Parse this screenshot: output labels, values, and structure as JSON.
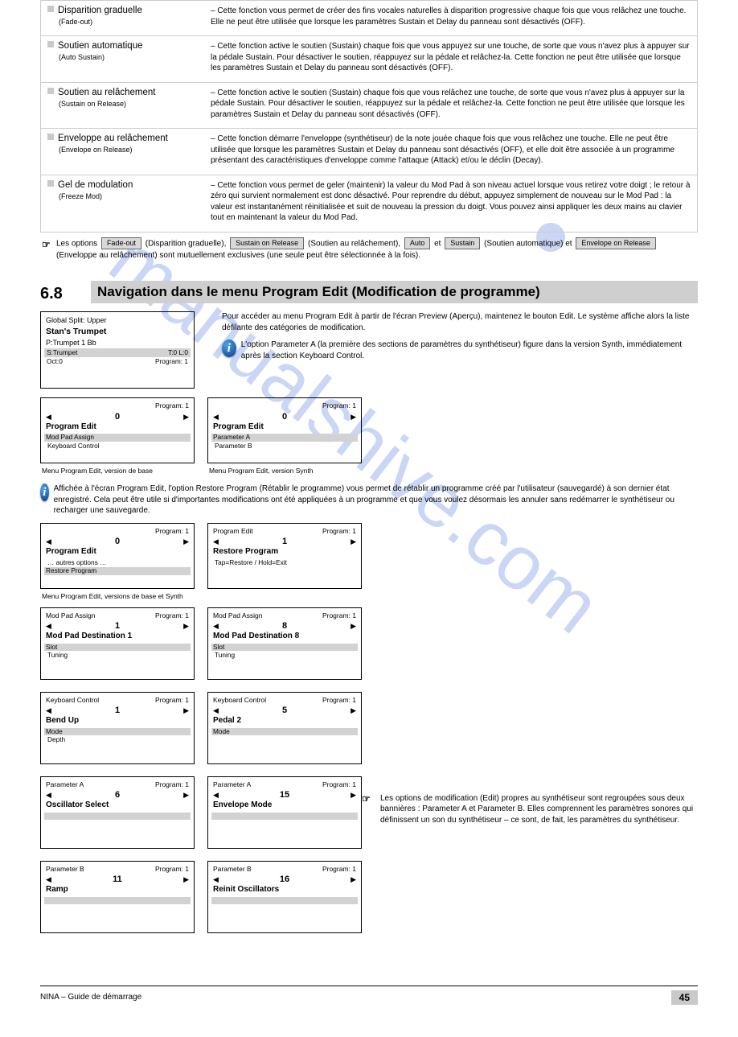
{
  "feature_table": [
    {
      "title": "Disparition graduelle",
      "sub": "(Fade-out)",
      "desc": "– Cette fonction vous permet de créer des fins vocales naturelles à disparition progressive chaque fois que vous relâchez une touche. Elle ne peut être utilisée que lorsque les paramètres Sustain et Delay du panneau sont désactivés (OFF)."
    },
    {
      "title": "Soutien automatique",
      "sub": "(Auto Sustain)",
      "desc": "– Cette fonction active le soutien (Sustain) chaque fois que vous appuyez sur une touche, de sorte que vous n'avez plus à appuyer sur la pédale Sustain. Pour désactiver le soutien, réappuyez sur la pédale et relâchez-la. Cette fonction ne peut être utilisée que lorsque les paramètres Sustain et Delay du panneau sont désactivés (OFF)."
    },
    {
      "title": "Soutien au relâchement",
      "sub": "(Sustain on Release)",
      "desc": "– Cette fonction active le soutien (Sustain) chaque fois que vous relâchez une touche, de sorte que vous n'avez plus à appuyer sur la pédale Sustain. Pour désactiver le soutien, réappuyez sur la pédale et relâchez-la. Cette fonction ne peut être utilisée que lorsque les paramètres Sustain et Delay du panneau sont désactivés (OFF)."
    },
    {
      "title": "Enveloppe au relâchement",
      "sub": "(Envelope on Release)",
      "desc": "– Cette fonction démarre l'enveloppe (synthétiseur) de la note jouée chaque fois que vous relâchez une touche. Elle ne peut être utilisée que lorsque les paramètres Sustain et Delay du panneau sont désactivés (OFF), et elle doit être associée à un programme présentant des caractéristiques d'enveloppe comme l'attaque (Attack) et/ou le déclin (Decay)."
    },
    {
      "title": "Gel de modulation",
      "sub": "(Freeze Mod)",
      "desc": "– Cette fonction vous permet de geler (maintenir) la valeur du Mod Pad à son niveau actuel lorsque vous retirez votre doigt ; le retour à zéro qui survient normalement est donc désactivé. Pour reprendre du début, appuyez simplement de nouveau sur le Mod Pad : la valeur est instantanément réinitialisée et suit de nouveau la pression du doigt. Vous pouvez ainsi appliquer les deux mains au clavier tout en maintenant la valeur du Mod Pad."
    }
  ],
  "note_after_table": {
    "pre": "Les options ",
    "btn1": "Fade-out",
    "mid1": " (Disparition graduelle), ",
    "btn2": "Sustain on Release",
    "mid2": " (Soutien au relâchement), ",
    "btn3": "Auto",
    "mid3": " et ",
    "btn4": "Sustain",
    "mid4": " (Soutien automatique) et ",
    "btn5": "Envelope on Release",
    "post": " (Enveloppe au relâchement) sont mutuellement exclusives (une seule peut être sélectionnée à la fois)."
  },
  "section": {
    "num": "6.8",
    "title": "Navigation dans le menu Program Edit (Modification de programme)"
  },
  "preview_panel": {
    "line1": "Global Split: Upper",
    "line2": "Stan's Trumpet",
    "line3": "P:Trumpet 1 Bb",
    "sel_left": "S:Trumpet",
    "sel_right": "T:0 L:0",
    "plain_left": "Oct:0",
    "plain_right": "Program: 1"
  },
  "panel_menu1": {
    "top": "Program: 1",
    "big": "Program Edit",
    "sel": "Mod Pad Assign",
    "plain": "Keyboard Control"
  },
  "panel_menu2": {
    "top": "Program: 1",
    "big": "Program Edit",
    "sel": "Parameter A",
    "plain": "Parameter B"
  },
  "under_menu1": "Menu Program Edit, version de base",
  "under_menu2": "Menu Program Edit, version Synth",
  "right_block": {
    "p1": "Pour accéder au menu Program Edit à partir de l'écran Preview (Aperçu), maintenez le bouton Edit. Le système affiche alors la liste défilante des catégories de modification.",
    "info": "L'option Parameter A (la première des sections de paramètres du synthétiseur) figure dans la version Synth, immédiatement après la section Keyboard Control."
  },
  "info_local": "Affichée à l'écran Program Edit, l'option Restore Program (Rétablir le programme) vous permet de rétablir un programme créé par l'utilisateur (sauvegardé) à son dernier état enregistré. Cela peut être utile si d'importantes modifications ont été appliquées à un programme et que vous voulez désormais les annuler sans redémarrer le synthétiseur ou recharger une sauvegarde.",
  "panel_restore1": {
    "top": "Program: 1",
    "big": "Program Edit",
    "opt1": "… autres options …",
    "opt_sel": "Restore Program"
  },
  "panel_restore2": {
    "top_left": "Program Edit",
    "top_right": "Program: 1",
    "big": "Restore Program",
    "desc": "Tap=Restore / Hold=Exit"
  },
  "under_restore": "Menu Program Edit, versions de base et Synth",
  "panel_mod_a": {
    "top_left": "Mod Pad Assign",
    "top_right": "Program: 1",
    "big": "Mod Pad Destination 1",
    "sel": "Slot",
    "opt": "Tuning"
  },
  "panel_mod_b": {
    "top_left": "Mod Pad Assign",
    "top_right": "Program: 1",
    "big": "Mod Pad Destination 8",
    "sel": "Slot",
    "opt": "Tuning"
  },
  "panel_kb_a": {
    "top_left": "Keyboard Control",
    "top_right": "Program: 1",
    "big": "Bend Up",
    "sel": "Mode",
    "opt": "Depth"
  },
  "panel_kb_b": {
    "top_left": "Keyboard Control",
    "top_right": "Program: 1",
    "big": "Pedal 2",
    "sel": "Mode",
    "opt": "none"
  },
  "panel_pA_a": {
    "top_left": "Parameter A",
    "top_right": "Program: 1",
    "big": "Oscillator Select",
    "opt": "none",
    "sel": ""
  },
  "panel_pA_b": {
    "top_left": "Parameter A",
    "top_right": "Program: 1",
    "big": "Envelope Mode",
    "opt": "none",
    "sel": ""
  },
  "panel_pB_a": {
    "top_left": "Parameter B",
    "top_right": "Program: 1",
    "big": "Ramp",
    "opt": "none",
    "sel": ""
  },
  "panel_pB_b": {
    "top_left": "Parameter B",
    "top_right": "Program: 1",
    "big": "Reinit Oscillators",
    "opt": "none",
    "sel": ""
  },
  "para_note": "Les options de modification (Edit) propres au synthétiseur sont regroupées sous deux bannières : Parameter A et Parameter B. Elles comprennent les paramètres sonores qui définissent un son du synthétiseur – ce sont, de fait, les paramètres du synthétiseur.",
  "num0": "0",
  "num1": "1",
  "num8": "8",
  "num15": "15",
  "num5": "5",
  "num6": "6",
  "num11": "11",
  "num16": "16",
  "footer": {
    "left": "NINA – Guide de démarrage",
    "right": "45"
  }
}
